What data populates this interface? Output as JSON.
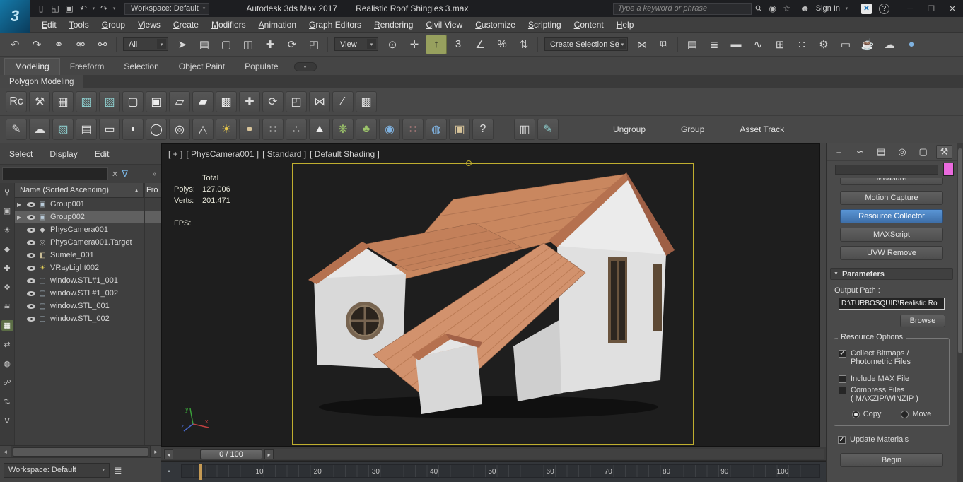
{
  "titlebar": {
    "logo_text": "3",
    "app_name": "Autodesk 3ds Max 2017",
    "file_name": "Realistic Roof Shingles 3.max",
    "workspace": "Workspace: Default",
    "search_placeholder": "Type a keyword or phrase",
    "sign_in": "Sign In"
  },
  "icons": {
    "new_file": "▯",
    "open_file": "◱",
    "save_file": "▣",
    "undo_small": "↶",
    "redo_small": "↷",
    "dropdown": "▾",
    "search": "⚲",
    "community": "◉",
    "favorites": "☆",
    "user": "☻",
    "exchange": "✕",
    "help": "?",
    "minimize": "─",
    "maximize": "❐",
    "close": "✕",
    "funnel": "∇",
    "chevrons": "»",
    "clear": "✕",
    "layers": "≣",
    "scroll_left": "◂",
    "scroll_right": "▸",
    "slider_prev": "◂",
    "slider_next": "▸",
    "track_key": "▪",
    "rollout_arrow": "▼",
    "ribbon_pill": "▾"
  },
  "menubar": [
    "Edit",
    "Tools",
    "Group",
    "Views",
    "Create",
    "Modifiers",
    "Animation",
    "Graph Editors",
    "Rendering",
    "Civil View",
    "Customize",
    "Scripting",
    "Content",
    "Help"
  ],
  "main_toolbar": {
    "group1": [
      {
        "name": "undo-icon",
        "glyph": "↶"
      },
      {
        "name": "redo-icon",
        "glyph": "↷"
      },
      {
        "name": "select-and-link-icon",
        "glyph": "⚭"
      },
      {
        "name": "unlink-selection-icon",
        "glyph": "⚮"
      },
      {
        "name": "bind-to-space-warp-icon",
        "glyph": "⚯"
      }
    ],
    "filter_value": "All",
    "group2": [
      {
        "name": "select-object-icon",
        "glyph": "➤"
      },
      {
        "name": "select-by-name-icon",
        "glyph": "▤"
      },
      {
        "name": "rectangular-selection-icon",
        "glyph": "▢"
      },
      {
        "name": "window-crossing-icon",
        "glyph": "◫"
      },
      {
        "name": "select-and-move-icon",
        "glyph": "✚"
      },
      {
        "name": "select-and-rotate-icon",
        "glyph": "⟳"
      },
      {
        "name": "select-and-scale-icon",
        "glyph": "◰"
      }
    ],
    "ref_coord_value": "View",
    "group3": [
      {
        "name": "use-pivot-center-icon",
        "glyph": "⊙"
      },
      {
        "name": "select-and-manipulate-icon",
        "glyph": "✛"
      },
      {
        "name": "keyboard-override-icon",
        "glyph": "↑",
        "active": true
      },
      {
        "name": "snaps-toggle-icon",
        "glyph": "3"
      },
      {
        "name": "angle-snap-icon",
        "glyph": "∠"
      },
      {
        "name": "percent-snap-icon",
        "glyph": "%"
      },
      {
        "name": "spinner-snap-icon",
        "glyph": "⇅"
      }
    ],
    "selection_set_value": "Create Selection Se",
    "group4": [
      {
        "name": "mirror-icon",
        "glyph": "⋈"
      },
      {
        "name": "align-icon",
        "glyph": "⧉"
      }
    ],
    "group5": [
      {
        "name": "scene-explorer-toggle-icon",
        "glyph": "▤"
      },
      {
        "name": "layer-explorer-icon",
        "glyph": "≣"
      },
      {
        "name": "ribbon-toggle-icon",
        "glyph": "▬"
      },
      {
        "name": "curve-editor-icon",
        "glyph": "∿"
      },
      {
        "name": "schematic-view-icon",
        "glyph": "⊞"
      },
      {
        "name": "material-editor-icon",
        "glyph": "∷"
      },
      {
        "name": "render-setup-icon",
        "glyph": "⚙"
      },
      {
        "name": "rendered-frame-icon",
        "glyph": "▭"
      },
      {
        "name": "render-production-icon",
        "glyph": "☕"
      },
      {
        "name": "render-a360-icon",
        "glyph": "☁"
      },
      {
        "name": "render-iray-icon",
        "glyph": "●",
        "cls": "c-blue"
      }
    ]
  },
  "ribbon": {
    "tabs": [
      {
        "name": "tab-modeling",
        "label": "Modeling",
        "active": true
      },
      {
        "name": "tab-freeform",
        "label": "Freeform"
      },
      {
        "name": "tab-selection",
        "label": "Selection"
      },
      {
        "name": "tab-object-paint",
        "label": "Object Paint"
      },
      {
        "name": "tab-populate",
        "label": "Populate"
      }
    ],
    "subtab": "Polygon Modeling"
  },
  "mod_toolbar": [
    {
      "name": "ribbon-config-icon",
      "glyph": "Rc"
    },
    {
      "name": "tools-icon",
      "glyph": "⚒"
    },
    {
      "name": "spreadsheet-icon",
      "glyph": "▦"
    },
    {
      "name": "image-preview-1-icon",
      "glyph": "▧",
      "cls": "c-teal"
    },
    {
      "name": "image-preview-2-icon",
      "glyph": "▨",
      "cls": "c-teal"
    },
    {
      "name": "box-primitive-icon",
      "glyph": "▢",
      "cls": "c-shape"
    },
    {
      "name": "rounded-box-icon",
      "glyph": "▣",
      "cls": "c-shape"
    },
    {
      "name": "plane-icon",
      "glyph": "▱",
      "cls": "c-shape"
    },
    {
      "name": "slanted-plane-icon",
      "glyph": "▰",
      "cls": "c-shape"
    },
    {
      "name": "lattice-icon",
      "glyph": "▩",
      "cls": "c-shape"
    },
    {
      "name": "move-tool-icon",
      "glyph": "✚"
    },
    {
      "name": "rotate-tool-icon",
      "glyph": "⟳"
    },
    {
      "name": "scale-tool-icon",
      "glyph": "◰"
    },
    {
      "name": "mirror-tool-icon",
      "glyph": "⋈"
    },
    {
      "name": "line-tool-icon",
      "glyph": "∕"
    },
    {
      "name": "checker-icon",
      "glyph": "▩"
    }
  ],
  "prim_toolbar": {
    "icons": [
      {
        "name": "pencil-icon",
        "glyph": "✎"
      },
      {
        "name": "cloud-icon",
        "glyph": "☁"
      },
      {
        "name": "photo-icon",
        "glyph": "▧",
        "cls": "c-teal"
      },
      {
        "name": "palette-icon",
        "glyph": "▤"
      },
      {
        "name": "rounded-rect-icon",
        "glyph": "▭",
        "cls": "c-shape"
      },
      {
        "name": "capsule-icon",
        "glyph": "◖",
        "cls": "c-shape"
      },
      {
        "name": "torus-icon",
        "glyph": "◯",
        "cls": "c-shape"
      },
      {
        "name": "donut-icon",
        "glyph": "◎",
        "cls": "c-shape"
      },
      {
        "name": "cone-icon",
        "glyph": "△",
        "cls": "c-shape"
      },
      {
        "name": "sun-icon",
        "glyph": "☀",
        "cls": "c-sun"
      },
      {
        "name": "sphere-icon",
        "glyph": "●",
        "cls": "c-tan"
      },
      {
        "name": "particle-grid-icon",
        "glyph": "∷"
      },
      {
        "name": "particle-spray-icon",
        "glyph": "∴"
      },
      {
        "name": "pyramid-icon",
        "glyph": "▲",
        "cls": "c-shape"
      },
      {
        "name": "foliage-icon",
        "glyph": "❋",
        "cls": "c-green"
      },
      {
        "name": "grass-icon",
        "glyph": "♣",
        "cls": "c-green"
      },
      {
        "name": "blue-sphere-icon",
        "glyph": "◉",
        "cls": "c-blue"
      },
      {
        "name": "color-dots-icon",
        "glyph": "∷",
        "cls": "c-multi"
      },
      {
        "name": "textured-sphere-icon",
        "glyph": "◍",
        "cls": "c-blue"
      },
      {
        "name": "crate-icon",
        "glyph": "▣",
        "cls": "c-tan"
      },
      {
        "name": "about-icon",
        "glyph": "?"
      },
      {
        "name": "lightboard-icon",
        "glyph": "▥",
        "cls": "gap-left"
      },
      {
        "name": "paint-bridge-icon",
        "glyph": "✎",
        "cls": "c-teal"
      }
    ],
    "buttons": [
      "Ungroup",
      "Group",
      "Asset Track"
    ]
  },
  "scene_explorer": {
    "menu": [
      "Select",
      "Display",
      "Edit"
    ],
    "header": "Name (Sorted Ascending)",
    "sort_arrow": "▲",
    "frozen_col": "Fro",
    "filters": [
      {
        "name": "find-icon",
        "glyph": "⚲"
      },
      {
        "name": "display-geometry-icon",
        "glyph": "▣"
      },
      {
        "name": "display-lights-icon",
        "glyph": "☀"
      },
      {
        "name": "display-cameras-icon",
        "glyph": "◆"
      },
      {
        "name": "display-helpers-icon",
        "glyph": "✚"
      },
      {
        "name": "display-shapes-icon",
        "glyph": "❖"
      },
      {
        "name": "display-spacewarps-icon",
        "glyph": "≋"
      },
      {
        "name": "display-groups-icon",
        "glyph": "▦",
        "active": true
      },
      {
        "name": "display-xrefs-icon",
        "glyph": "⇄"
      },
      {
        "name": "display-materials-icon",
        "glyph": "◍"
      },
      {
        "name": "display-bones-icon",
        "glyph": "☍"
      },
      {
        "name": "sort-icon",
        "glyph": "⇅"
      },
      {
        "name": "filter-icon",
        "glyph": "∇"
      }
    ],
    "rows": [
      {
        "label": "Group001",
        "arrow": "▶",
        "icon": "▣",
        "type": "group"
      },
      {
        "label": "Group002",
        "arrow": "▶",
        "icon": "▣",
        "type": "group",
        "selected": true
      },
      {
        "label": "PhysCamera001",
        "arrow": "",
        "icon": "◆",
        "type": "camera"
      },
      {
        "label": "PhysCamera001.Target",
        "arrow": "",
        "icon": "◎",
        "type": "target"
      },
      {
        "label": "Sumele_001",
        "arrow": "",
        "icon": "◧",
        "type": "mesh"
      },
      {
        "label": "VRayLight002",
        "arrow": "",
        "icon": "☀",
        "type": "light"
      },
      {
        "label": "window.STL#1_001",
        "arrow": "",
        "icon": "▢",
        "type": "geometry"
      },
      {
        "label": "window.STL#1_002",
        "arrow": "",
        "icon": "▢",
        "type": "geometry"
      },
      {
        "label": "window.STL_001",
        "arrow": "",
        "icon": "▢",
        "type": "geometry"
      },
      {
        "label": "window.STL_002",
        "arrow": "",
        "icon": "▢",
        "type": "geometry"
      }
    ],
    "workspace": "Workspace: Default"
  },
  "viewport": {
    "labels": [
      "[ + ]",
      "[ PhysCamera001 ]",
      "[ Standard ]",
      "[ Default Shading ]"
    ],
    "stats": {
      "total": "Total",
      "polys_label": "Polys:",
      "polys_value": "127.006",
      "verts_label": "Verts:",
      "verts_value": "201.471",
      "fps_label": "FPS:"
    },
    "axis_labels": {
      "x": "x",
      "y": "y",
      "z": "z"
    }
  },
  "timeline": {
    "frame": "0 / 100",
    "ticks": [
      "10",
      "20",
      "30",
      "40",
      "50",
      "60",
      "70",
      "80",
      "90",
      "100"
    ]
  },
  "command_panel": {
    "tabs": [
      {
        "name": "create-tab-icon",
        "glyph": "+"
      },
      {
        "name": "modify-tab-icon",
        "glyph": "∽"
      },
      {
        "name": "hierarchy-tab-icon",
        "glyph": "▤"
      },
      {
        "name": "motion-tab-icon",
        "glyph": "◎"
      },
      {
        "name": "display-tab-icon",
        "glyph": "▢"
      },
      {
        "name": "utilities-tab-icon",
        "glyph": "⚒",
        "active": true
      }
    ],
    "utilities": [
      {
        "label": "Measure"
      },
      {
        "label": "Motion Capture"
      },
      {
        "label": "Resource Collector",
        "active": true
      },
      {
        "label": "MAXScript"
      },
      {
        "label": "UVW Remove"
      }
    ],
    "parameters": {
      "title": "Parameters",
      "output_path_label": "Output Path :",
      "output_path_value": "D:\\TURBOSQUID\\Realistic Ro",
      "browse": "Browse",
      "group_title": "Resource Options",
      "collect_line1": "Collect Bitmaps /",
      "collect_line2": "Photometric Files",
      "collect_checked": true,
      "include_max": "Include MAX File",
      "include_checked": false,
      "compress_line1": "Compress Files",
      "compress_line2": "( MAXZIP/WINZIP )",
      "compress_checked": false,
      "copy": "Copy",
      "copy_checked": true,
      "move": "Move",
      "move_checked": false,
      "update_materials": "Update Materials",
      "update_checked": true,
      "begin": "Begin"
    }
  }
}
